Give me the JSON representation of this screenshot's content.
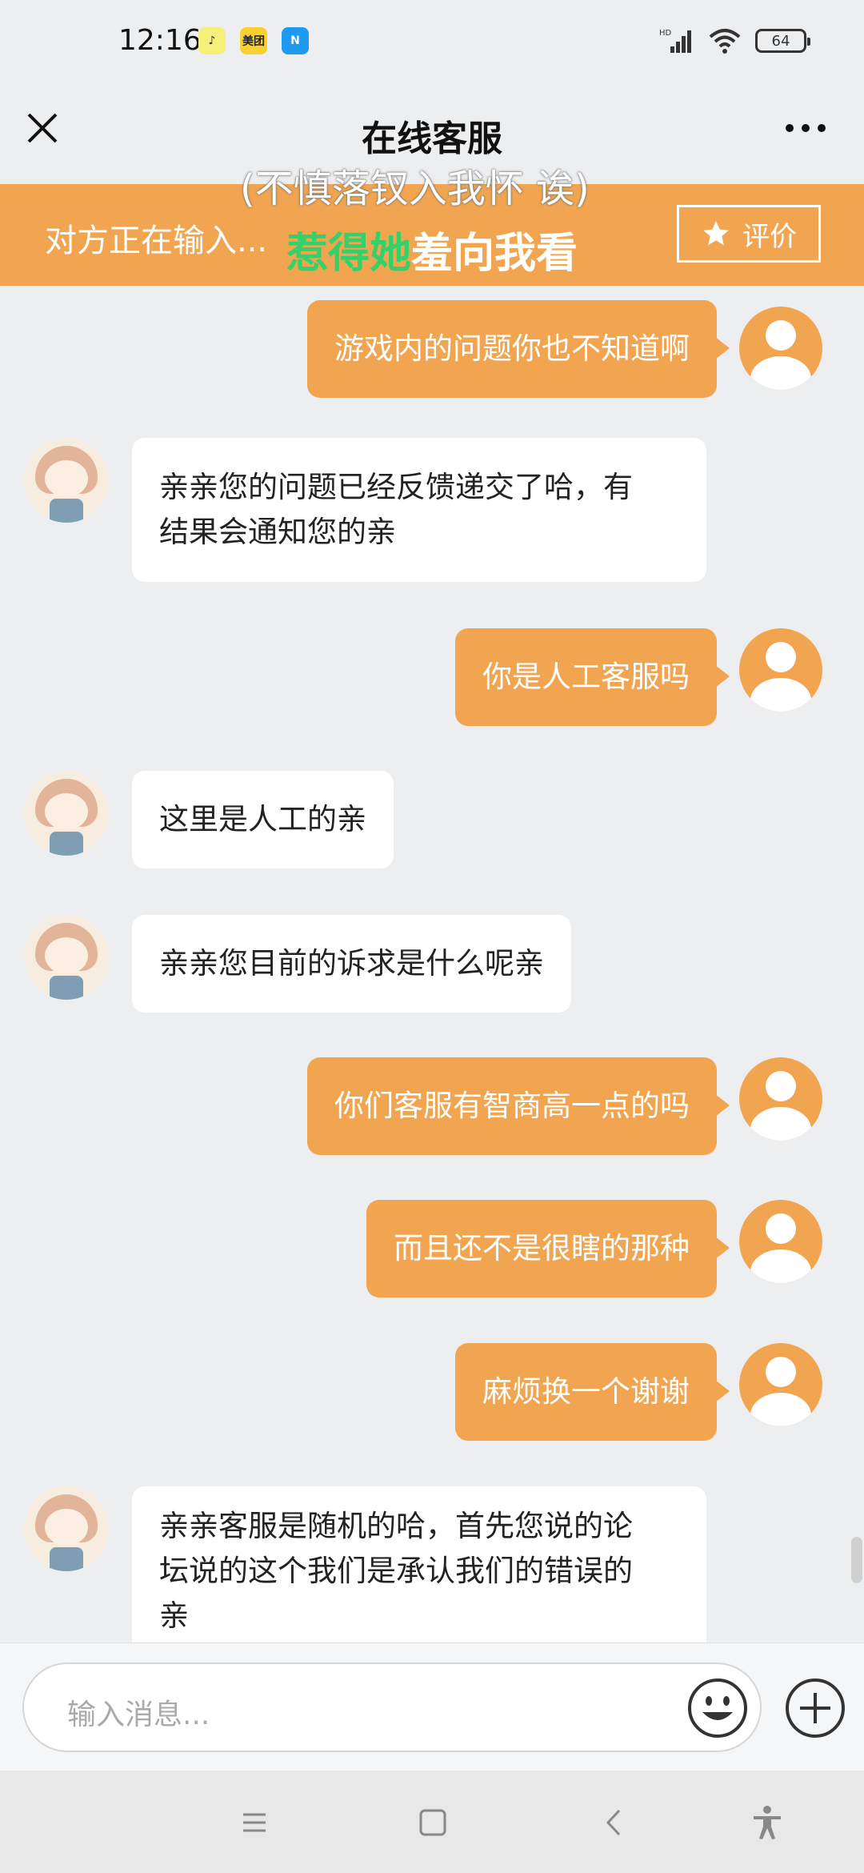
{
  "status_bar": {
    "time": "12:16",
    "apps": [
      {
        "name": "qq-music",
        "label": "♪",
        "color": "#f5f07a"
      },
      {
        "name": "meituan",
        "label": "美团",
        "color": "#f8d030"
      },
      {
        "name": "app-n",
        "label": "N",
        "color": "#1e9af0"
      }
    ],
    "signal": "HD",
    "battery": "64"
  },
  "header": {
    "title": "在线客服",
    "caption_top": "(不慎落钗入我怀 诶)",
    "typing_text": "对方正在输入...",
    "caption_bottom_green": "惹得她",
    "caption_bottom_rest": "羞向我看",
    "rate_label": "评价"
  },
  "messages": [
    {
      "from": "user",
      "text": "游戏内的问题你也不知道啊"
    },
    {
      "from": "agent",
      "lines": [
        "亲亲您的问题已经反馈递交了哈，有",
        "结果会通知您的亲"
      ]
    },
    {
      "from": "user",
      "text": "你是人工客服吗"
    },
    {
      "from": "agent",
      "text": "这里是人工的亲"
    },
    {
      "from": "agent",
      "text": "亲亲您目前的诉求是什么呢亲"
    },
    {
      "from": "user",
      "text": "你们客服有智商高一点的吗"
    },
    {
      "from": "user",
      "text": "而且还不是很瞎的那种"
    },
    {
      "from": "user",
      "text": "麻烦换一个谢谢"
    },
    {
      "from": "agent",
      "lines": [
        "亲亲客服是随机的哈，首先您说的论",
        "坛说的这个我们是承认我们的错误的",
        "亲"
      ]
    }
  ],
  "input": {
    "placeholder": "输入消息..."
  },
  "colors": {
    "accent": "#f2a550",
    "background": "#edeef0",
    "caption_green": "#35d06a"
  }
}
